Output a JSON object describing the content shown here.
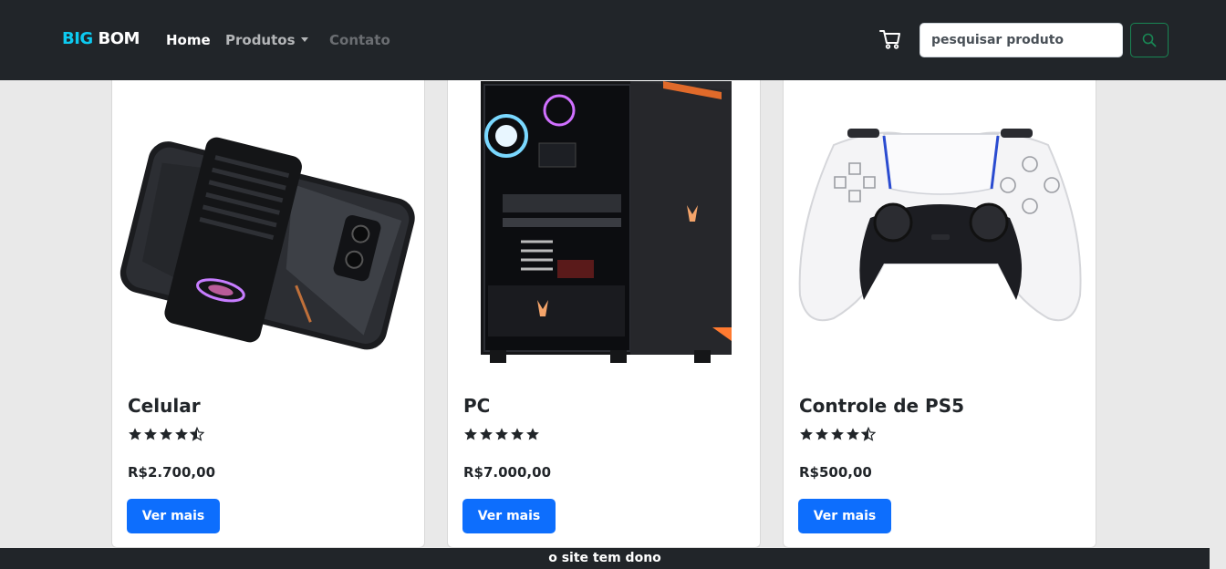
{
  "navbar": {
    "brand_part1": "BIG",
    "brand_part2": "BOM",
    "links": {
      "home": "Home",
      "produtos": "Produtos",
      "contato": "Contato"
    },
    "cart_icon": "cart-icon",
    "search_placeholder": "pesquisar produto",
    "search_icon": "search-icon"
  },
  "products": [
    {
      "title": "Celular",
      "rating": 4.5,
      "price": "R$2.700,00",
      "button": "Ver mais",
      "image": "gaming-phone"
    },
    {
      "title": "PC",
      "rating": 5,
      "price": "R$7.000,00",
      "button": "Ver mais",
      "image": "gaming-pc-tower"
    },
    {
      "title": "Controle de PS5",
      "rating": 4.5,
      "price": "R$500,00",
      "button": "Ver mais",
      "image": "ps5-controller"
    }
  ],
  "footer": {
    "text": "o site tem dono"
  },
  "colors": {
    "navbar_bg": "#212529",
    "brand_accent": "#0dcaf0",
    "primary_button": "#0d6efd",
    "search_button_border": "#198754",
    "page_bg": "#e9e9e9"
  }
}
